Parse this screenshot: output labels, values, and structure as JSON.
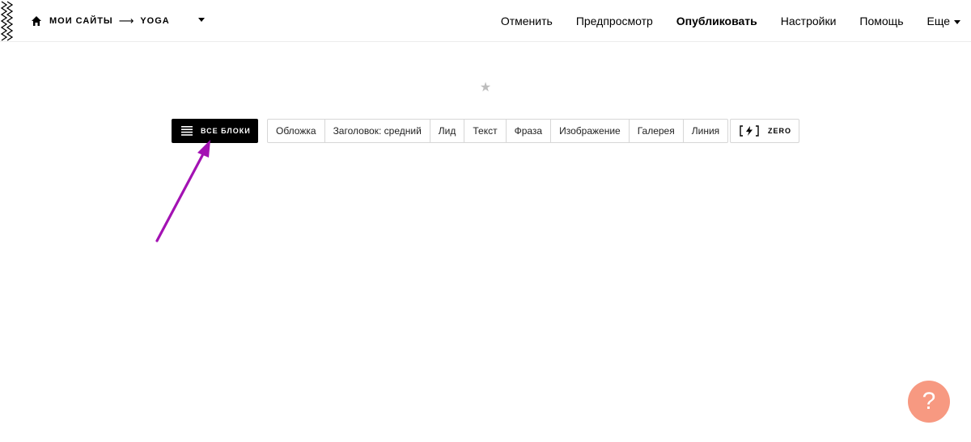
{
  "breadcrumb": {
    "home_icon": "home-icon",
    "root": "МОИ САЙТЫ",
    "separator": "⟶",
    "site": "YOGA"
  },
  "top_menu": {
    "undo": "Отменить",
    "preview": "Предпросмотр",
    "publish": "Опубликовать",
    "settings": "Настройки",
    "help": "Помощь",
    "more": "Еще"
  },
  "toolbar": {
    "all_blocks": "ВСЕ БЛОКИ",
    "block_types": [
      "Обложка",
      "Заголовок: средний",
      "Лид",
      "Текст",
      "Фраза",
      "Изображение",
      "Галерея",
      "Линия"
    ],
    "zero": "ZERO"
  },
  "favorite_icon": "star-icon",
  "help_button": {
    "label": "?",
    "color": "#f79981"
  },
  "annotation": {
    "color": "#a312b3"
  }
}
